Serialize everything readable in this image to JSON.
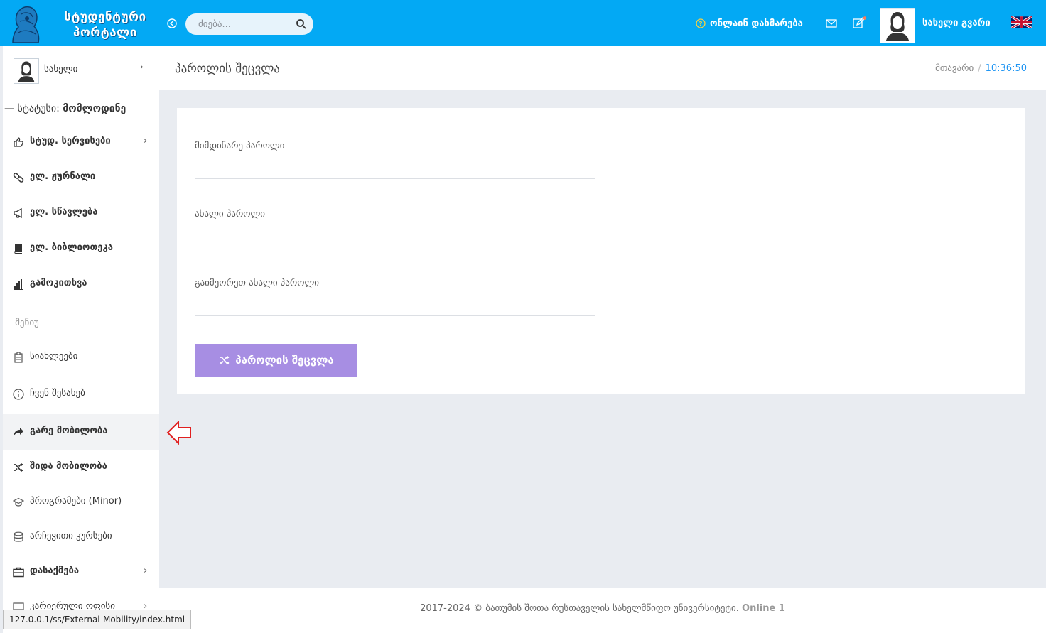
{
  "header": {
    "logo_text": "სტუდენტური პორტალი",
    "search_placeholder": "ძიება...",
    "help_label": "ონლაინ დახმარება",
    "user_name": "სახელი გვარი",
    "language_flag": "uk-flag-icon",
    "accent_color": "#03a9f4"
  },
  "sidebar": {
    "profile_name": "სახელი",
    "status_prefix": "— სტატუსი: ",
    "status_value": "მომლოდინე",
    "items": [
      {
        "label": "სტუდ. სერვისები",
        "icon": "thumbs-up-icon",
        "bold": true,
        "chevron": true
      },
      {
        "label": "ელ. ჟურნალი",
        "icon": "link-icon",
        "bold": true
      },
      {
        "label": "ელ. სწავლება",
        "icon": "megaphone-icon",
        "bold": true
      },
      {
        "label": "ელ. ბიბლიოთეკა",
        "icon": "book-icon",
        "bold": true
      },
      {
        "label": "გამოკითხვა",
        "icon": "bar-chart-icon",
        "bold": true
      }
    ],
    "menu_divider": "— მენიუ —",
    "menu_items": [
      {
        "label": "სიახლეები",
        "icon": "clipboard-icon",
        "bold": false
      },
      {
        "label": "ჩვენ შესახებ",
        "icon": "info-icon",
        "bold": false
      },
      {
        "label": "გარე მობილობა",
        "icon": "share-icon",
        "bold": true,
        "active": true
      },
      {
        "label": "შიდა მობილობა",
        "icon": "shuffle-icon",
        "bold": true
      },
      {
        "label": "პროგრამები (Minor)",
        "icon": "graduation-cap-icon",
        "bold": false
      },
      {
        "label": "არჩევითი კურსები",
        "icon": "database-icon",
        "bold": false
      },
      {
        "label": "დასაქმება",
        "icon": "briefcase-icon",
        "bold": true,
        "chevron": true
      },
      {
        "label": "კარიერული ოფისი",
        "icon": "monitor-icon",
        "bold": false,
        "chevron": true
      }
    ]
  },
  "page": {
    "title": "პაროლის შეცვლა",
    "breadcrumb_home": "მთავარი",
    "breadcrumb_sep": "/",
    "breadcrumb_time": "10:36:50"
  },
  "form": {
    "current_password_label": "მიმდინარე პაროლი",
    "new_password_label": "ახალი პაროლი",
    "repeat_password_label": "გაიმეორეთ ახალი პაროლი",
    "submit_label": "პაროლის შეცვლა",
    "submit_color": "#a78ee3"
  },
  "footer": {
    "text": "2017-2024 © ბათუმის შოთა რუსთაველის სახელმწიფო უნივერსიტეტი.",
    "online": "Online 1"
  },
  "browser_status_url": "127.0.0.1/ss/External-Mobility/index.html"
}
